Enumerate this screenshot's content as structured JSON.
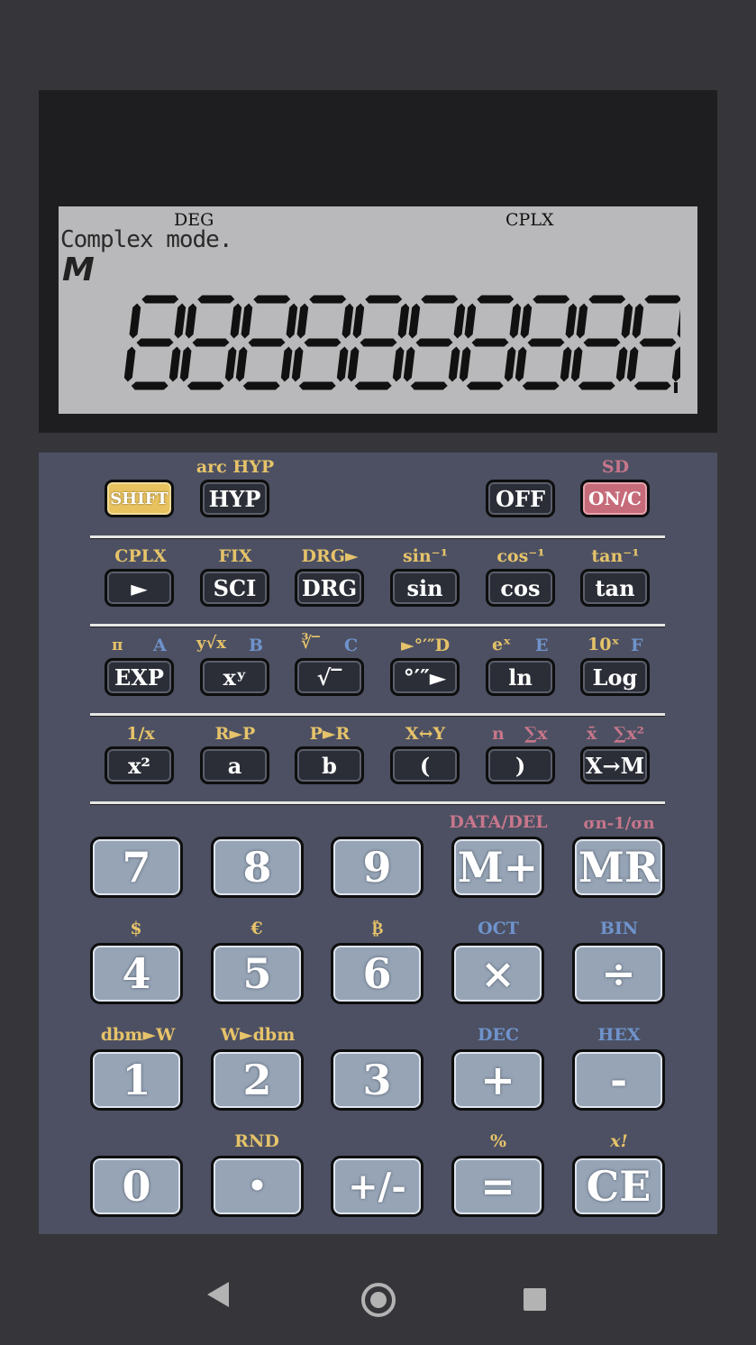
{
  "display": {
    "indicator_deg": "DEG",
    "indicator_cplx": "CPLX",
    "message": "Complex mode.",
    "memory_indicator": "M",
    "digit_count": 10
  },
  "labels": {
    "arc_hyp": "arc HYP",
    "sd": "SD",
    "cplx": "CPLX",
    "fix": "FIX",
    "drg_arrow": "DRG►",
    "sin_inv": "sin⁻¹",
    "cos_inv": "cos⁻¹",
    "tan_inv": "tan⁻¹",
    "pi": "π",
    "a": "A",
    "yroot": "y√x",
    "b": "B",
    "cuberoot": "∛‾",
    "c": "C",
    "to_dms": "►°′″D",
    "e_pow": "eˣ",
    "e": "E",
    "ten_pow": "10ˣ",
    "f": "F",
    "recip": "1/x",
    "r_to_p": "R►P",
    "p_to_r": "P►R",
    "x_swap_y": "X↔Y",
    "n": "n",
    "sum_x": "∑x",
    "x_bar": "x̄",
    "sum_x2": "∑x²",
    "data_del": "DATA/DEL",
    "sigma": "σn-1/σn",
    "dollar": "$",
    "euro": "€",
    "bitcoin": "₿",
    "oct": "OCT",
    "bin": "BIN",
    "dbm_w": "dbm►W",
    "w_dbm": "W►dbm",
    "dec": "DEC",
    "hex": "HEX",
    "rnd": "RND",
    "percent": "%",
    "factorial": "x!"
  },
  "keys": {
    "shift": "SHIFT",
    "hyp": "HYP",
    "off": "OFF",
    "on_c": "ON/C",
    "arrow": "►",
    "sci": "SCI",
    "drg": "DRG",
    "sin": "sin",
    "cos": "cos",
    "tan": "tan",
    "exp": "EXP",
    "x_pow_y": "xʸ",
    "sqrt": "√‾",
    "dms": "°′″►",
    "ln": "ln",
    "log": "Log",
    "x_sq": "x²",
    "a": "a",
    "b": "b",
    "lparen": "(",
    "rparen": ")",
    "x_to_m": "X→M",
    "n7": "7",
    "n8": "8",
    "n9": "9",
    "m_plus": "M+",
    "mr": "MR",
    "n4": "4",
    "n5": "5",
    "n6": "6",
    "times": "×",
    "divide": "÷",
    "n1": "1",
    "n2": "2",
    "n3": "3",
    "plus": "+",
    "minus": "-",
    "n0": "0",
    "dot": "•",
    "sign": "+/-",
    "equals": "=",
    "ce": "CE"
  },
  "navigation": {
    "back": "back",
    "home": "home",
    "recents": "recents"
  }
}
